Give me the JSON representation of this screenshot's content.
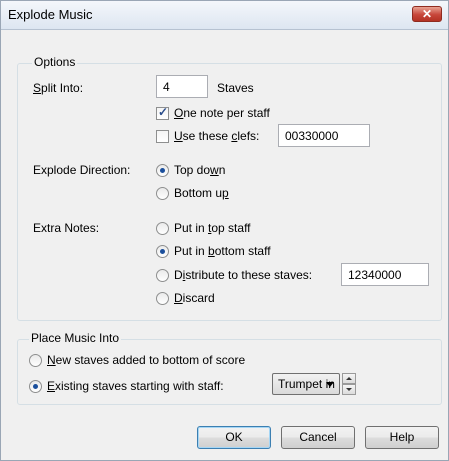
{
  "window": {
    "title": "Explode Music",
    "close_glyph": "✕"
  },
  "options": {
    "group_label": "Options",
    "split_into": {
      "label_underlined": "S",
      "label_rest": "plit Into:",
      "value": "4",
      "suffix": "Staves"
    },
    "one_note_per_staff": {
      "checked": true,
      "label_underlined": "O",
      "label_rest": "ne note per staff"
    },
    "use_these_clefs": {
      "checked": false,
      "label_underlined": "U",
      "label_mid": "se these ",
      "label_underlined2": "c",
      "label_rest": "lefs:",
      "value": "00330000"
    },
    "explode_direction": {
      "label": "Explode Direction:",
      "top_down": {
        "selected": true,
        "label_pre": "Top do",
        "label_underlined": "w",
        "label_rest": "n"
      },
      "bottom_up": {
        "selected": false,
        "label_pre": "Bottom u",
        "label_underlined": "p",
        "label_rest": ""
      }
    },
    "extra_notes": {
      "label": "Extra Notes:",
      "top_staff": {
        "selected": false,
        "label_pre": "Put in ",
        "label_underlined": "t",
        "label_rest": "op staff"
      },
      "bottom_staff": {
        "selected": true,
        "label_pre": "Put in ",
        "label_underlined": "b",
        "label_rest": "ottom staff"
      },
      "distribute": {
        "selected": false,
        "label_pre": "D",
        "label_underlined": "i",
        "label_rest": "stribute to these staves:",
        "value": "12340000"
      },
      "discard": {
        "selected": false,
        "label_pre": "",
        "label_underlined": "D",
        "label_rest": "iscard"
      }
    }
  },
  "place_music": {
    "group_label": "Place Music Into",
    "new_staves": {
      "selected": false,
      "label_underlined": "N",
      "label_rest": "ew staves added to bottom of score"
    },
    "existing_staves": {
      "selected": true,
      "label_underlined": "E",
      "label_rest": "xisting staves starting with staff:",
      "select_value": "Trumpet in"
    }
  },
  "buttons": {
    "ok": "OK",
    "cancel": "Cancel",
    "help": "Help"
  },
  "colors": {
    "dialog_bg": "#f0f0f0",
    "close_button": "#c7463a",
    "radio_dot": "#1b4f9c"
  }
}
